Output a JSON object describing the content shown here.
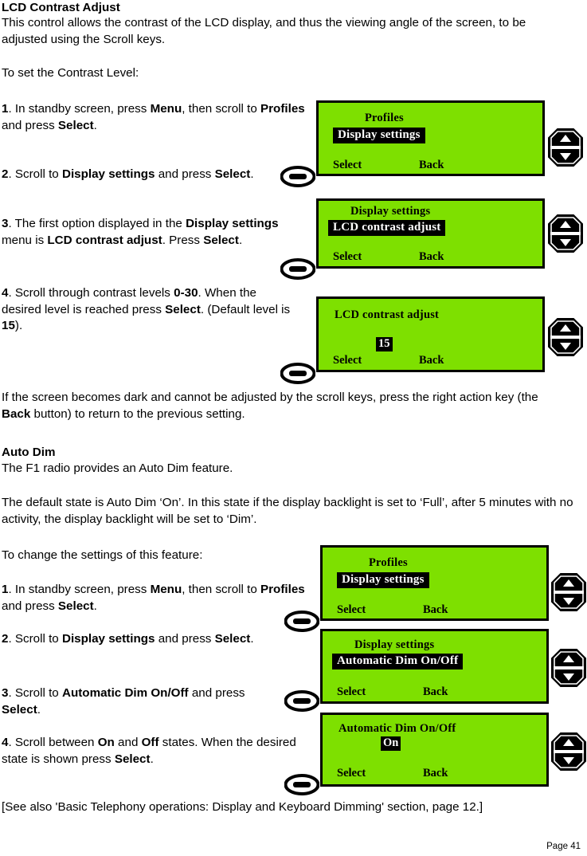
{
  "document": {
    "section_title": "LCD Contrast Adjust",
    "intro": "This control allows the contrast of the LCD display, and thus the viewing angle of the screen, to be adjusted using the Scroll keys.",
    "lead_in": "To set the Contrast Level:",
    "note_paragraph": "If the screen becomes dark and cannot be adjusted by the scroll keys, press the right action key (the Back button) to return to the previous setting.",
    "autodim_title": "Auto Dim",
    "autodim_intro": "The F1 radio provides an Auto Dim feature.",
    "autodim_default": "The default state is Auto Dim ‘On’. In this state if the display backlight is set to ‘Full’, after 5 minutes with no activity, the display backlight will be set to ‘Dim’.",
    "autodim_lead_in": "To change the settings of this feature:",
    "see_also": "[See also 'Basic Telephony operations: Display and Keyboard Dimming' section, page 12.]",
    "page_number": "Page 41"
  },
  "contrast_steps": {
    "step1": {
      "number": "1",
      "parts": [
        {
          "text": ". In standby screen, press ",
          "bold": false
        },
        {
          "text": "Menu",
          "bold": true
        },
        {
          "text": ", then scroll to ",
          "bold": false
        },
        {
          "text": "Profiles",
          "bold": true
        },
        {
          "text": " and press ",
          "bold": false
        },
        {
          "text": "Select",
          "bold": true
        },
        {
          "text": ".",
          "bold": false
        }
      ]
    },
    "step2": {
      "number": "2",
      "parts": [
        {
          "text": ". Scroll to ",
          "bold": false
        },
        {
          "text": "Display settings",
          "bold": true
        },
        {
          "text": " and press ",
          "bold": false
        },
        {
          "text": "Select",
          "bold": true
        },
        {
          "text": ".",
          "bold": false
        }
      ]
    },
    "step3": {
      "number": "3",
      "parts": [
        {
          "text": ". The first option displayed in the ",
          "bold": false
        },
        {
          "text": "Display settings",
          "bold": true
        },
        {
          "text": " menu is ",
          "bold": false
        },
        {
          "text": "LCD contrast adjust",
          "bold": true
        },
        {
          "text": ". Press ",
          "bold": false
        },
        {
          "text": "Select",
          "bold": true
        },
        {
          "text": ".",
          "bold": false
        }
      ]
    },
    "step4": {
      "number": "4",
      "parts": [
        {
          "text": ". Scroll through contrast levels ",
          "bold": false
        },
        {
          "text": "0-30",
          "bold": true
        },
        {
          "text": ". When the desired level is reached press ",
          "bold": false
        },
        {
          "text": "Select",
          "bold": true
        },
        {
          "text": ". (Default level is ",
          "bold": false
        },
        {
          "text": "15",
          "bold": true
        },
        {
          "text": ").",
          "bold": false
        }
      ]
    }
  },
  "autodim_steps": {
    "step1": {
      "number": "1",
      "parts": [
        {
          "text": ". In standby screen, press ",
          "bold": false
        },
        {
          "text": "Menu",
          "bold": true
        },
        {
          "text": ", then scroll to ",
          "bold": false
        },
        {
          "text": "Profiles",
          "bold": true
        },
        {
          "text": " and press ",
          "bold": false
        },
        {
          "text": "Select",
          "bold": true
        },
        {
          "text": ".",
          "bold": false
        }
      ]
    },
    "step2": {
      "number": "2",
      "parts": [
        {
          "text": ". Scroll to ",
          "bold": false
        },
        {
          "text": "Display settings",
          "bold": true
        },
        {
          "text": " and press ",
          "bold": false
        },
        {
          "text": "Select",
          "bold": true
        },
        {
          "text": ".",
          "bold": false
        }
      ]
    },
    "step3": {
      "number": "3",
      "parts": [
        {
          "text": ". Scroll to ",
          "bold": false
        },
        {
          "text": "Automatic Dim On/Off",
          "bold": true
        },
        {
          "text": " and press ",
          "bold": false
        },
        {
          "text": "Select",
          "bold": true
        },
        {
          "text": ".",
          "bold": false
        }
      ]
    },
    "step4": {
      "number": "4",
      "parts": [
        {
          "text": ". Scroll between ",
          "bold": false
        },
        {
          "text": "On",
          "bold": true
        },
        {
          "text": " and ",
          "bold": false
        },
        {
          "text": "Off",
          "bold": true
        },
        {
          "text": " states. When the desired state is shown press ",
          "bold": false
        },
        {
          "text": "Select",
          "bold": true
        },
        {
          "text": ".",
          "bold": false
        }
      ]
    }
  },
  "lcd_screens": [
    {
      "id": "profiles-display-settings-1",
      "title": "Profiles",
      "highlight": "Display settings",
      "value": null,
      "softkey_left": "Select",
      "softkey_right": "Back"
    },
    {
      "id": "display-settings-lcd-contrast",
      "title": "Display settings",
      "highlight": "LCD contrast adjust",
      "value": null,
      "softkey_left": "Select",
      "softkey_right": "Back"
    },
    {
      "id": "lcd-contrast-adjust-value",
      "title": "LCD contrast adjust",
      "highlight": null,
      "value": "15",
      "softkey_left": "Select",
      "softkey_right": "Back"
    },
    {
      "id": "profiles-display-settings-2",
      "title": "Profiles",
      "highlight": "Display settings",
      "value": null,
      "softkey_left": "Select",
      "softkey_right": "Back"
    },
    {
      "id": "display-settings-automatic-dim",
      "title": "Display settings",
      "highlight": "Automatic Dim On/Off",
      "value": null,
      "softkey_left": "Select",
      "softkey_right": "Back"
    },
    {
      "id": "automatic-dim-on-off-value",
      "title": "Automatic Dim On/Off",
      "highlight": null,
      "value": "On",
      "softkey_left": "Select",
      "softkey_right": "Back"
    }
  ],
  "icons": {
    "scroll_key": "scroll-key-icon",
    "select_key": "select-key-icon"
  },
  "colors": {
    "lcd_background": "#7ee000",
    "lcd_text": "#000000",
    "highlight_background": "#000000",
    "highlight_text": "#ffffff",
    "page_background": "#ffffff"
  }
}
